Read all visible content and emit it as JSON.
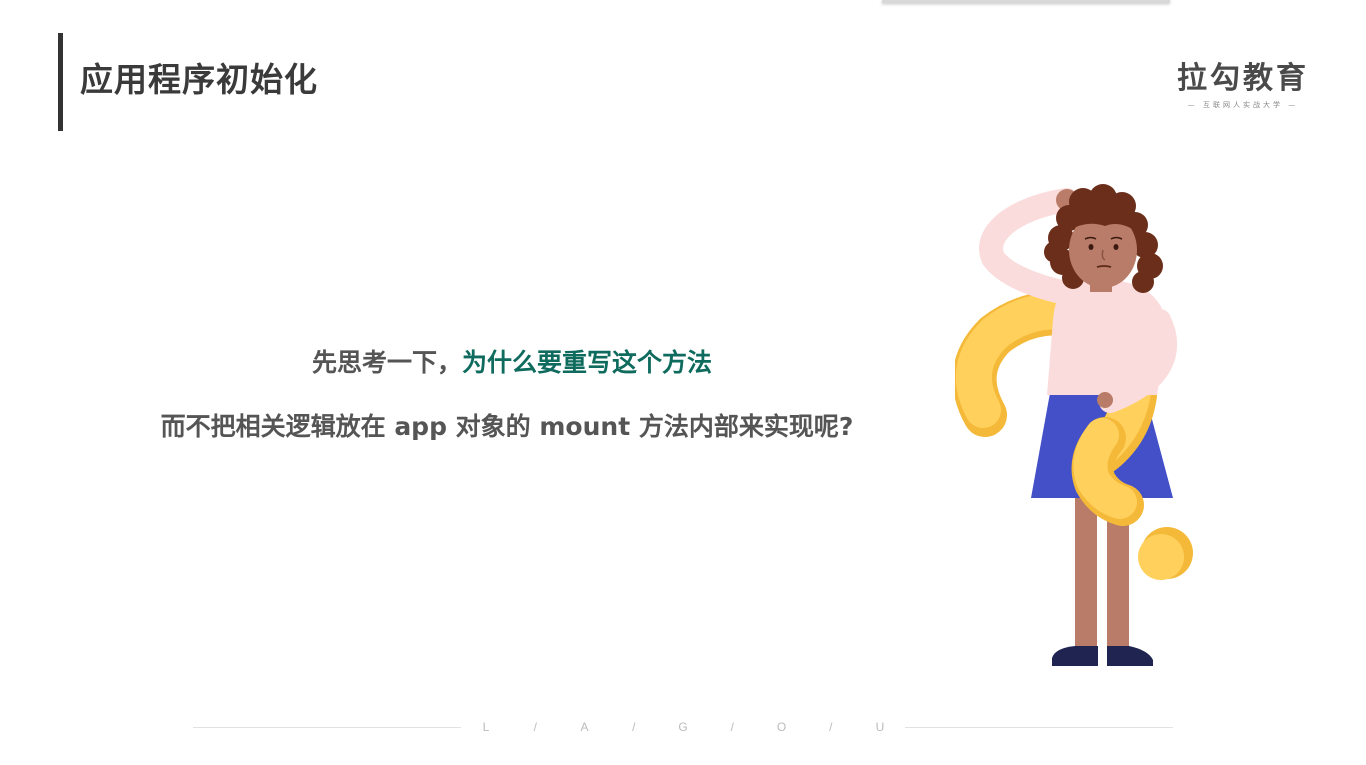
{
  "slide": {
    "title": "应用程序初始化"
  },
  "logo": {
    "name": "拉勾教育",
    "tagline": "— 互联网人实战大学 —"
  },
  "question": {
    "line1_prefix": "先思考一下，",
    "line1_highlight": "为什么要重写这个方法",
    "line2": "而不把相关逻辑放在 app 对象的 mount 方法内部来实现呢?"
  },
  "footer": {
    "letters": [
      "L",
      "/",
      "A",
      "/",
      "G",
      "/",
      "O",
      "/",
      "U"
    ]
  },
  "colors": {
    "title_text": "#3a3a3a",
    "body_text": "#555555",
    "highlight": "#0f6b5e",
    "question_mark": "#ffc94d",
    "skirt": "#4350c8",
    "shirt": "#fbdcdc",
    "hair": "#6b2e1a",
    "skin": "#b97c68"
  },
  "icons": {
    "illustration": "thinking-woman-question-mark-illustration"
  }
}
